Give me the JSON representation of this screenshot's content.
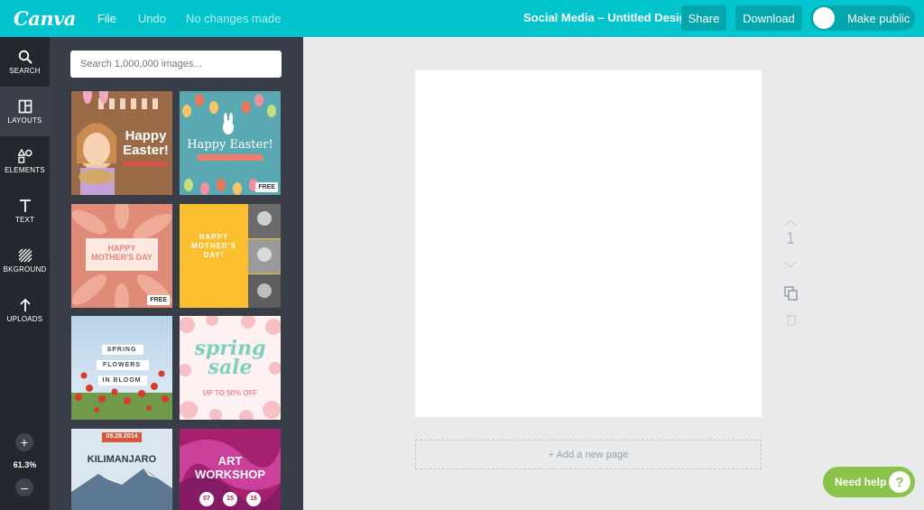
{
  "app": {
    "logo": "Canva",
    "menu": {
      "file": "File",
      "undo": "Undo",
      "status": "No changes made"
    },
    "design_title": "Social Media – Untitled Design",
    "actions": {
      "share": "Share",
      "download": "Download",
      "make_public": "Make public"
    }
  },
  "sidebar": {
    "items": [
      {
        "label": "SEARCH",
        "icon": "search-icon"
      },
      {
        "label": "LAYOUTS",
        "icon": "layouts-icon"
      },
      {
        "label": "ELEMENTS",
        "icon": "elements-icon"
      },
      {
        "label": "TEXT",
        "icon": "text-icon"
      },
      {
        "label": "BKGROUND",
        "icon": "background-icon"
      },
      {
        "label": "UPLOADS",
        "icon": "uploads-icon"
      }
    ],
    "zoom": {
      "in": "+",
      "level": "61.3%",
      "out": "–"
    }
  },
  "panel": {
    "search_placeholder": "Search 1,000,000 images...",
    "templates": [
      {
        "title_line1": "Happy",
        "title_line2": "Easter!",
        "subtitle": "",
        "badge": ""
      },
      {
        "title": "Happy Easter!",
        "subtitle": "",
        "badge": "FREE"
      },
      {
        "title_line1": "HAPPY",
        "title_line2": "MOTHER'S DAY",
        "badge": "FREE"
      },
      {
        "title_line1": "HAPPY",
        "title_line2": "MOTHER'S",
        "title_line3": "DAY!",
        "badge": ""
      },
      {
        "lines": [
          "SPRING",
          "FLOWERS",
          "IN BLOOM"
        ],
        "badge": ""
      },
      {
        "title_line1": "spring",
        "title_line2": "sale",
        "subtitle": "UP TO 50% OFF",
        "badge": ""
      },
      {
        "date": "09.28.2014",
        "title": "KILIMANJARO",
        "badge": ""
      },
      {
        "title_line1": "ART",
        "title_line2": "WORKSHOP",
        "dates": [
          "07",
          "15",
          "16"
        ],
        "badge": ""
      }
    ]
  },
  "canvas": {
    "page_number": "1",
    "add_page": "+ Add a new page"
  },
  "help": {
    "label": "Need help",
    "icon_text": "?"
  },
  "colors": {
    "topbar": "#02c4cc",
    "button": "#03a6ad",
    "rail": "#23272e",
    "panel": "#383d47",
    "help": "#8bc34a"
  }
}
